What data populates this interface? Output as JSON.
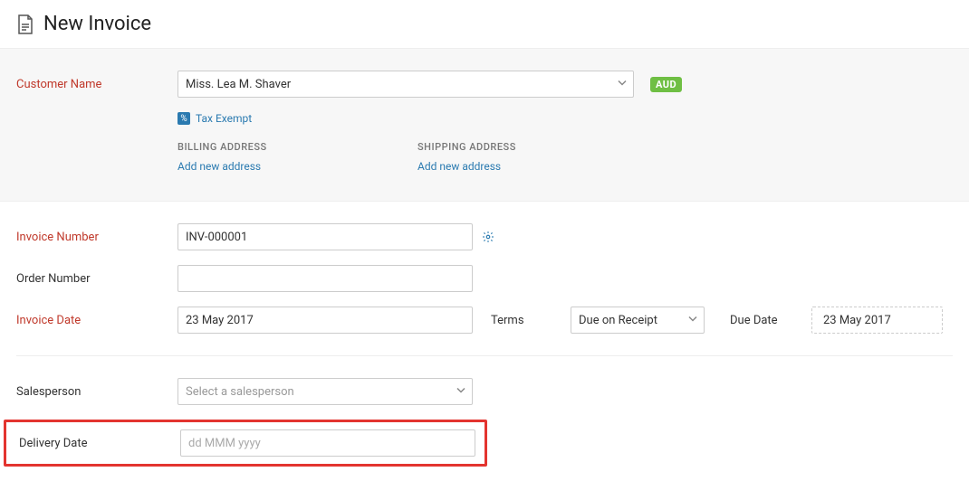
{
  "header": {
    "title": "New Invoice"
  },
  "customer": {
    "label": "Customer Name",
    "value": "Miss. Lea M. Shaver",
    "currency_badge": "AUD",
    "tax_exempt_label": "Tax Exempt",
    "billing_title": "BILLING ADDRESS",
    "billing_link": "Add new address",
    "shipping_title": "SHIPPING ADDRESS",
    "shipping_link": "Add new address"
  },
  "invoice": {
    "number_label": "Invoice Number",
    "number_value": "INV-000001",
    "order_label": "Order Number",
    "order_value": "",
    "date_label": "Invoice Date",
    "date_value": "23 May 2017",
    "terms_label": "Terms",
    "terms_value": "Due on Receipt",
    "due_label": "Due Date",
    "due_value": "23 May 2017"
  },
  "sales": {
    "salesperson_label": "Salesperson",
    "salesperson_placeholder": "Select a salesperson",
    "delivery_label": "Delivery Date",
    "delivery_placeholder": "dd MMM yyyy"
  }
}
